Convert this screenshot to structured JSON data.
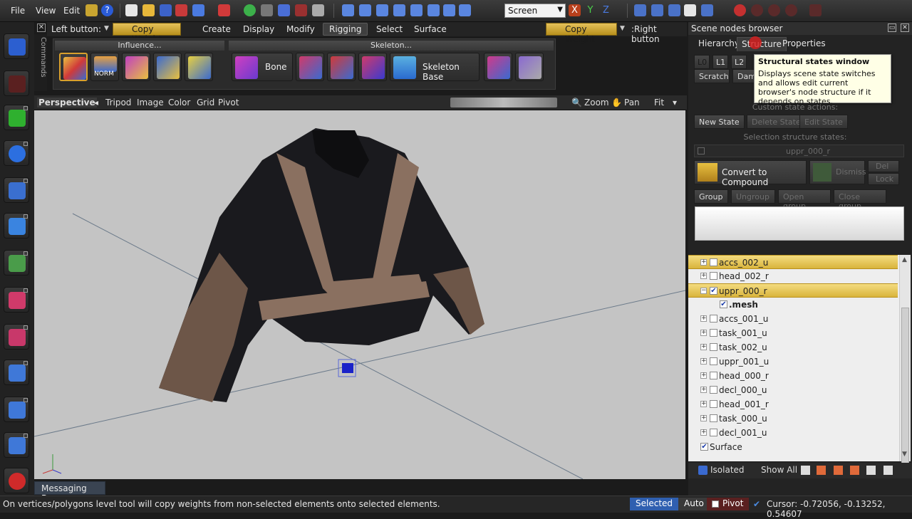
{
  "menubar": {
    "file": "File",
    "view": "View",
    "edit": "Edit",
    "help_icon": "help-icon",
    "screen_value": "Screen"
  },
  "modebar": {
    "left_button_label": "Left button:",
    "left_button_value": "Copy Weight",
    "right_button_value": "Copy Weight",
    "right_button_label": ":Right button",
    "tabs": [
      "Create",
      "Display",
      "Modify",
      "Rigging",
      "Select",
      "Surface"
    ],
    "active_tab": "Rigging"
  },
  "commands_label": "Commands",
  "ribbon": {
    "influence_title": "Influence...",
    "skeleton_title": "Skeleton...",
    "norm_label": "NORM",
    "bone_label": "Bone",
    "skeleton_base_label": "Skeleton Base"
  },
  "viewport_header": {
    "perspective": "Perspective",
    "tripod": "Tripod",
    "image": "Image",
    "color": "Color",
    "grid": "Grid",
    "pivot": "Pivot",
    "zoom": "Zoom",
    "pan": "Pan",
    "fit": "Fit"
  },
  "messaging_bar": "Messaging Bar",
  "status": {
    "message": "On vertices/polygons level tool will copy weights from non-selected elements onto selected elements.",
    "selected": "Selected",
    "auto": "Auto",
    "pivot": "Pivot",
    "cursor": "Cursor: -0.72056, -0.13252, 0.54607"
  },
  "panel": {
    "title": "Scene nodes browser",
    "tabs": [
      "Hierarchy",
      "Structure",
      "Properties"
    ],
    "levels": [
      "L0",
      "L1",
      "L2"
    ],
    "scratch": "Scratch",
    "dam": "Dam",
    "custom_state_actions": "Custom state actions:",
    "new_state": "New State",
    "delete_state": "Delete State",
    "edit_state": "Edit State",
    "selection_structure_states": "Selection structure states:",
    "state_item": "uppr_000_r",
    "convert_to_compound": "Convert to Compound",
    "dismiss": "Dismiss",
    "del": "Del",
    "lock": "Lock",
    "group": "Group",
    "ungroup": "Ungroup",
    "open_group": "Open group",
    "close_group": "Close group",
    "tooltip_title": "Structural states window",
    "tooltip_text": "Displays scene state switches and allows edit current browser's node structure if it depends on states.",
    "tree": [
      {
        "label": "accs_002_u",
        "checked": false,
        "selected": true
      },
      {
        "label": "head_002_r",
        "checked": false,
        "selected": false
      },
      {
        "label": "uppr_000_r",
        "checked": true,
        "selected": true
      },
      {
        "label": ".mesh",
        "checked": true,
        "selected": false
      },
      {
        "label": "accs_001_u",
        "checked": false,
        "selected": false
      },
      {
        "label": "task_001_u",
        "checked": false,
        "selected": false
      },
      {
        "label": "task_002_u",
        "checked": false,
        "selected": false
      },
      {
        "label": "uppr_001_u",
        "checked": false,
        "selected": false
      },
      {
        "label": "head_000_r",
        "checked": false,
        "selected": false
      },
      {
        "label": "decl_000_u",
        "checked": false,
        "selected": false
      },
      {
        "label": "head_001_r",
        "checked": false,
        "selected": false
      },
      {
        "label": "task_000_u",
        "checked": false,
        "selected": false
      },
      {
        "label": "decl_001_u",
        "checked": false,
        "selected": false
      },
      {
        "label": "Surface",
        "checked": true,
        "selected": false
      }
    ],
    "isolated": "Isolated",
    "show_all": "Show All"
  }
}
